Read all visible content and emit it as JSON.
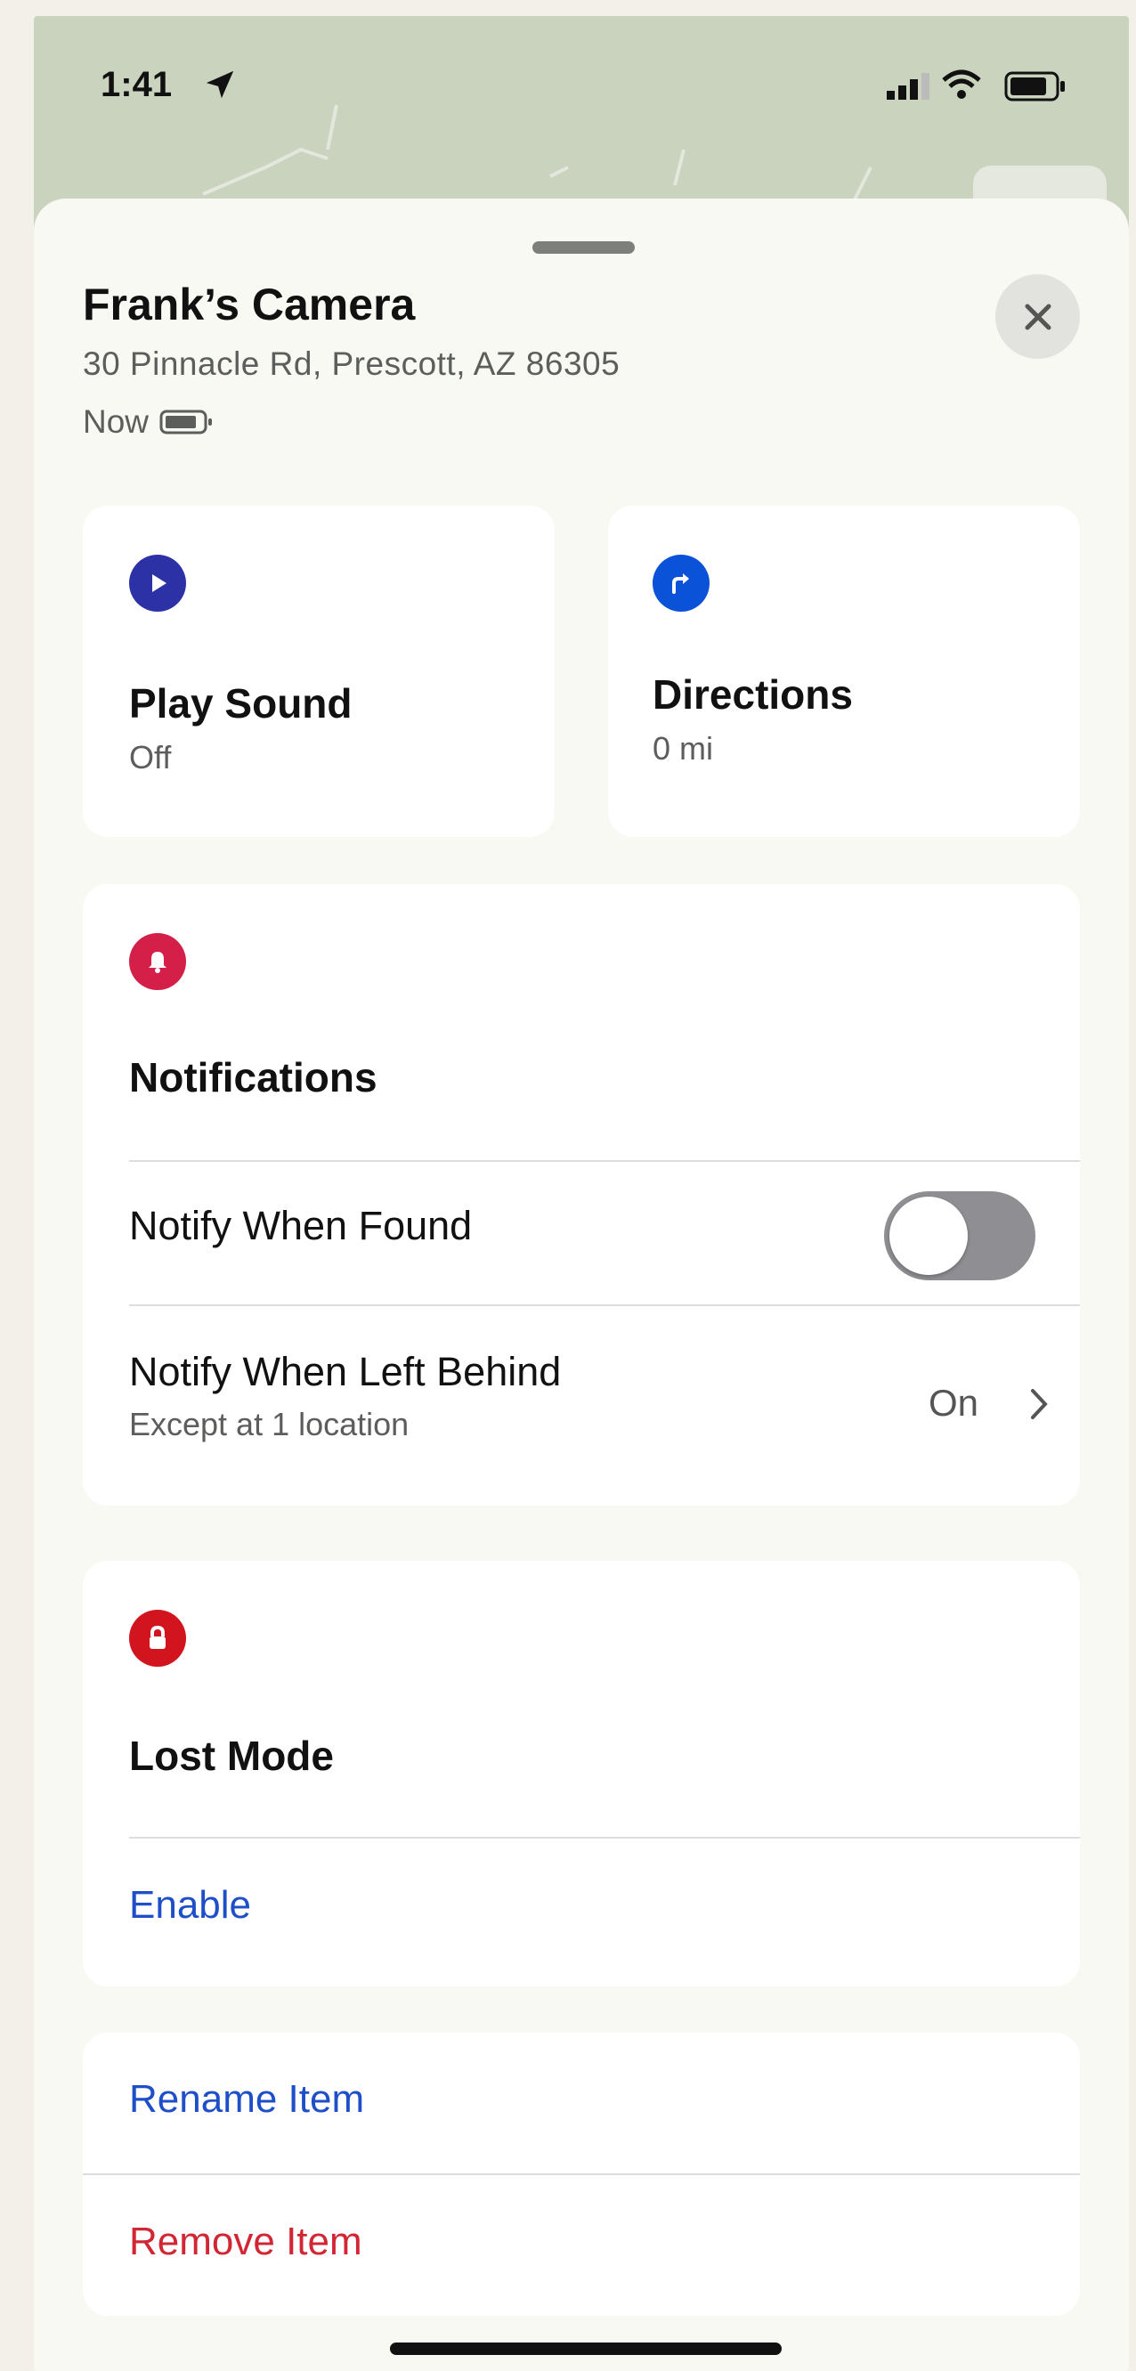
{
  "status_bar": {
    "time": "1:41"
  },
  "item": {
    "title": "Frank’s Camera",
    "address": "30 Pinnacle Rd, Prescott, AZ  86305",
    "updated": "Now"
  },
  "actions": {
    "play_sound": {
      "label": "Play Sound",
      "status": "Off"
    },
    "directions": {
      "label": "Directions",
      "distance": "0 mi"
    }
  },
  "notifications": {
    "heading": "Notifications",
    "notify_when_found": {
      "label": "Notify When Found",
      "enabled": false
    },
    "notify_when_left_behind": {
      "label": "Notify When Left Behind",
      "sublabel": "Except at 1 location",
      "value": "On"
    }
  },
  "lost_mode": {
    "heading": "Lost Mode",
    "enable_label": "Enable"
  },
  "item_actions": {
    "rename_label": "Rename Item",
    "remove_label": "Remove Item"
  },
  "colors": {
    "play_icon": "#2d31a6",
    "directions_icon": "#0a52d8",
    "notifications_icon": "#d41f48",
    "lost_mode_icon": "#d2141e",
    "link_blue": "#1f4fc8",
    "link_red": "#d12634"
  },
  "icons": {
    "play": "play-icon",
    "directions": "turn-right-arrow-icon",
    "notifications": "bell-icon",
    "lost_mode": "lock-icon",
    "close": "close-icon",
    "chevron": "chevron-right-icon"
  }
}
